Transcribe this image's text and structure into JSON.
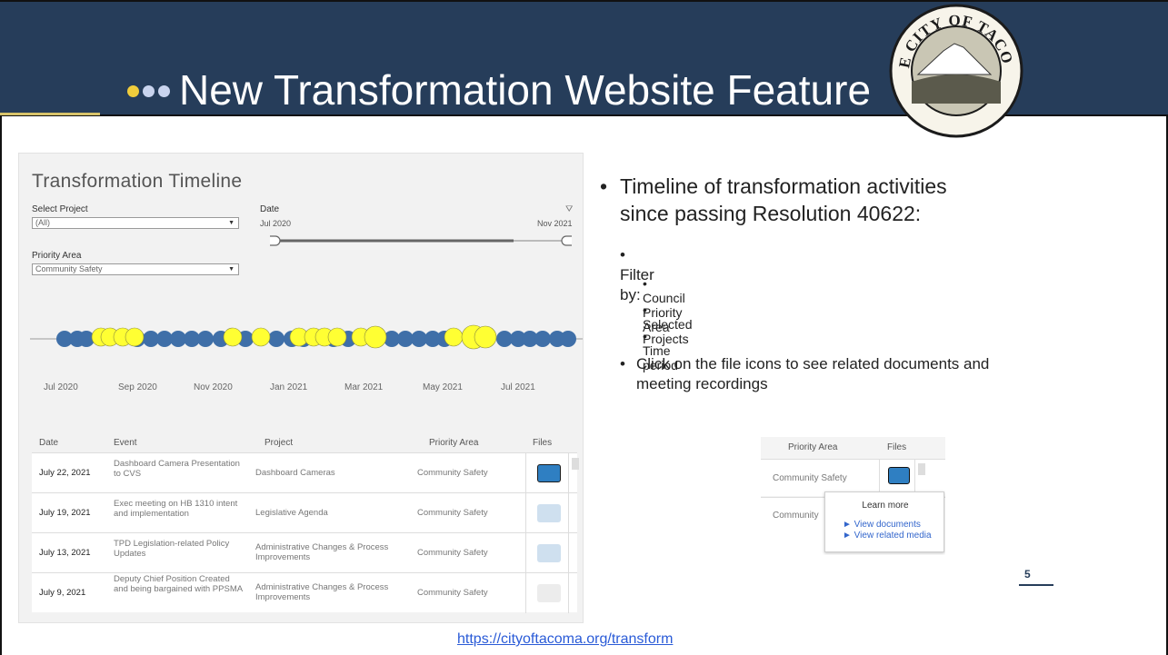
{
  "slide": {
    "title": "New Transformation Website Feature",
    "page_number": "5",
    "url": "https://cityoftacoma.org/transform",
    "seal_text": "THE CITY OF TACOMA"
  },
  "colors": {
    "header_bg": "#263d5a",
    "dot_gold": "#f0cd3c",
    "dot_light": "#c9d4ee",
    "timeline_blue": "#3f6fa8",
    "timeline_yellow": "#ffff33",
    "link": "#2a5bd7"
  },
  "timeline_panel": {
    "title": "Transformation Timeline",
    "select_project_label": "Select Project",
    "select_project_value": "(All)",
    "priority_area_label": "Priority Area",
    "priority_area_value": "Community Safety",
    "date_label": "Date",
    "date_min": "Jul 2020",
    "date_max": "Nov 2021",
    "months": [
      "Jul 2020",
      "Sep 2020",
      "Nov 2020",
      "Jan 2021",
      "Mar 2021",
      "May 2021",
      "Jul 2021"
    ],
    "table_headers": {
      "date": "Date",
      "event": "Event",
      "project": "Project",
      "priority": "Priority Area",
      "files": "Files"
    },
    "rows": [
      {
        "date": "July 22, 2021",
        "event": "Dashboard Camera Presentation to CVS",
        "project": "Dashboard Cameras",
        "priority": "Community Safety",
        "file_state": "active"
      },
      {
        "date": "July 19, 2021",
        "event": "Exec meeting on HB 1310 intent and implementation",
        "project": "Legislative Agenda",
        "priority": "Community Safety",
        "file_state": "faded"
      },
      {
        "date": "July 13, 2021",
        "event": "TPD Legislation-related Policy Updates",
        "project": "Administrative Changes & Process Improvements",
        "priority": "Community Safety",
        "file_state": "faded"
      },
      {
        "date": "July 9, 2021",
        "event": "Deputy Chief Position Created and being bargained with PPSMA",
        "project": "Administrative Changes & Process Improvements",
        "priority": "Community Safety",
        "file_state": "none"
      }
    ]
  },
  "bullets": {
    "main": "Timeline of transformation activities since passing Resolution 40622:",
    "filter_by": "Filter by:",
    "filters": [
      "Council Priority Area",
      "Selected Projects",
      "Time period"
    ],
    "click_note": "Click on the file icons to see related documents and meeting recordings"
  },
  "files_inset": {
    "priority_header": "Priority Area",
    "files_header": "Files",
    "row1_priority": "Community Safety",
    "row2_priority": "Community",
    "popup_title": "Learn more",
    "popup_link1": "► View documents",
    "popup_link2": "► View related media"
  }
}
